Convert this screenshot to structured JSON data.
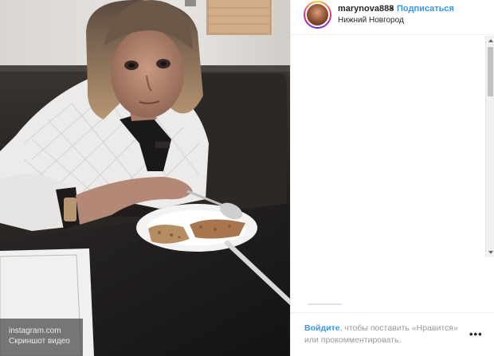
{
  "post": {
    "username": "marynova888",
    "separator": "•",
    "follow_label": "Подписаться",
    "location": "Нижний Новгород"
  },
  "watermark": {
    "line1": "instagram.com",
    "line2": "Скриншот видео"
  },
  "footer": {
    "login_label": "Войдите",
    "text_after_login": ", чтобы поставить «Нравится» или прокомментировать.",
    "more_icon": "more-horizontal-icon",
    "more_glyph": "•••"
  },
  "colors": {
    "link": "#3897f0",
    "text": "#262626",
    "muted": "#999999"
  }
}
